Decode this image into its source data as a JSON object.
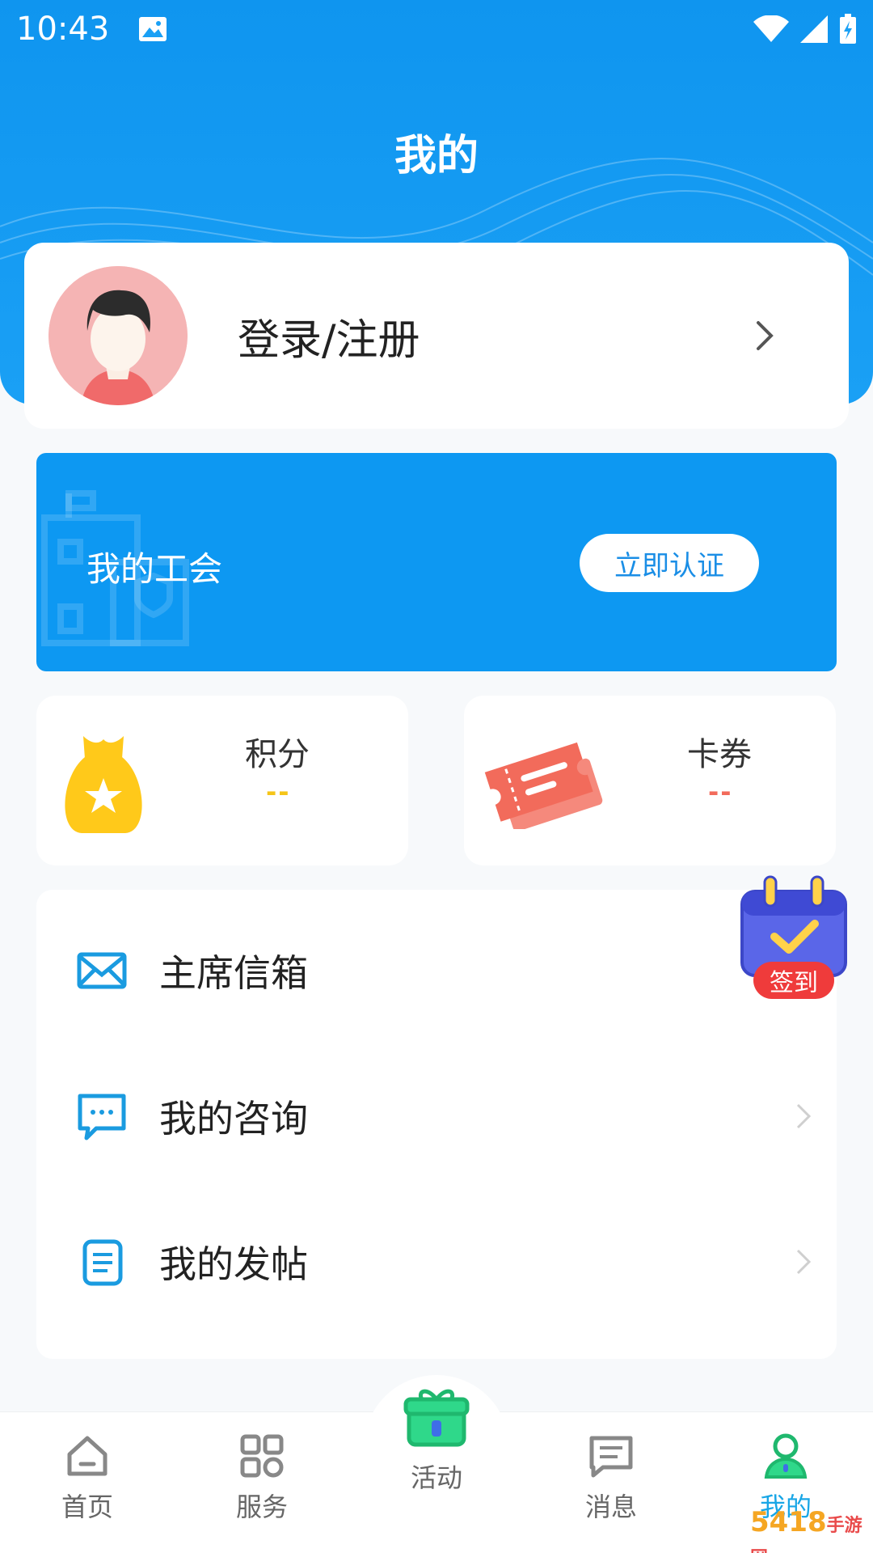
{
  "status_bar": {
    "time": "10:43"
  },
  "header": {
    "title": "我的"
  },
  "profile": {
    "login_label": "登录/注册"
  },
  "union": {
    "title": "我的工会",
    "verify_button": "立即认证"
  },
  "stats": {
    "points": {
      "label": "积分",
      "value": "--",
      "color": "#f5c518"
    },
    "coupons": {
      "label": "卡券",
      "value": "--",
      "color": "#f26b5b"
    }
  },
  "menu": {
    "items": [
      {
        "label": "主席信箱",
        "icon": "mail-icon"
      },
      {
        "label": "我的咨询",
        "icon": "chat-icon"
      },
      {
        "label": "我的发帖",
        "icon": "document-icon"
      }
    ]
  },
  "checkin": {
    "label": "签到"
  },
  "tabbar": {
    "items": [
      {
        "label": "首页",
        "icon": "home-icon"
      },
      {
        "label": "服务",
        "icon": "grid-icon"
      },
      {
        "label": "活动",
        "icon": "gift-icon"
      },
      {
        "label": "消息",
        "icon": "message-icon"
      },
      {
        "label": "我的",
        "icon": "user-icon",
        "active": true
      }
    ]
  },
  "watermark": {
    "brand": "5418",
    "site": "手游网"
  },
  "colors": {
    "primary": "#0d98f2",
    "active_tab": "#18a6e6",
    "checkin_badge": "#ef3b3b"
  }
}
